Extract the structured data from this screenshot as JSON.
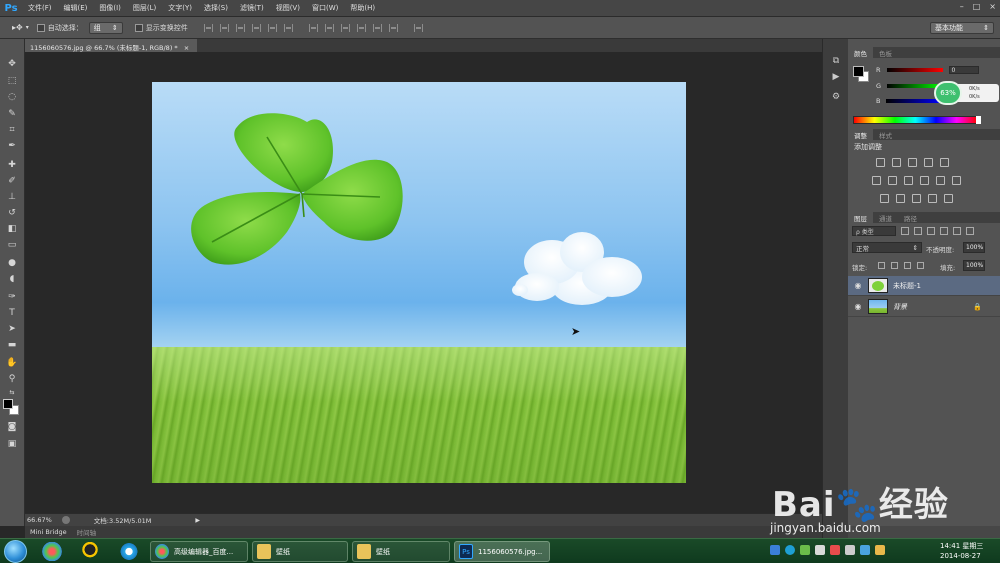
{
  "app": {
    "logo": "Ps",
    "menus": [
      "文件(F)",
      "编辑(E)",
      "图像(I)",
      "图层(L)",
      "文字(Y)",
      "选择(S)",
      "滤镜(T)",
      "视图(V)",
      "窗口(W)",
      "帮助(H)"
    ],
    "window_controls": [
      "–",
      "□",
      "×"
    ]
  },
  "options": {
    "tool_glyph": "▸✥",
    "auto_select_label": "自动选择：",
    "auto_select_value": "组",
    "show_transform_label": "显示变换控件",
    "workspace": "基本功能"
  },
  "document": {
    "tab_title": "1156060576.jpg @ 66.7% (未标题-1, RGB/8) *",
    "tab_close": "×"
  },
  "status": {
    "zoom": "66.67%",
    "doc_info": "文档:3.52M/5.01M",
    "arrow": "▶"
  },
  "bottom_tabs": [
    "Mini Bridge",
    "时间轴"
  ],
  "panels": {
    "color_tabs": [
      "颜色",
      "色板"
    ],
    "color": {
      "r_label": "R",
      "g_label": "G",
      "b_label": "B",
      "r_value": "0"
    },
    "speed_badge": "63%",
    "speed_up": "0K/s",
    "speed_down": "0K/s",
    "adjust_tabs": [
      "调整",
      "样式"
    ],
    "adjust_title": "添加调整",
    "layers_tabs": [
      "图层",
      "通道",
      "路径"
    ],
    "filter_label": "ρ 类型",
    "blend_mode": "正常",
    "opacity_label": "不透明度:",
    "opacity_value": "100%",
    "lock_label": "锁定:",
    "fill_label": "填充:",
    "fill_value": "100%",
    "layers": [
      {
        "name": "未标题-1",
        "selected": true
      },
      {
        "name": "背景",
        "selected": false
      }
    ]
  },
  "watermark": {
    "brand": "Bai🐾经验",
    "url": "jingyan.baidu.com"
  },
  "taskbar": {
    "tasks": [
      "高级编辑器_百度...",
      "壁纸",
      "壁纸",
      "1156060576.jpg..."
    ],
    "clock_time": "14:41 星期三",
    "clock_date": "2014-08-27"
  },
  "colors": {
    "accent": "#31a8ff",
    "selected_layer": "#5b6a82",
    "speed_badge": "#3ec06f"
  }
}
